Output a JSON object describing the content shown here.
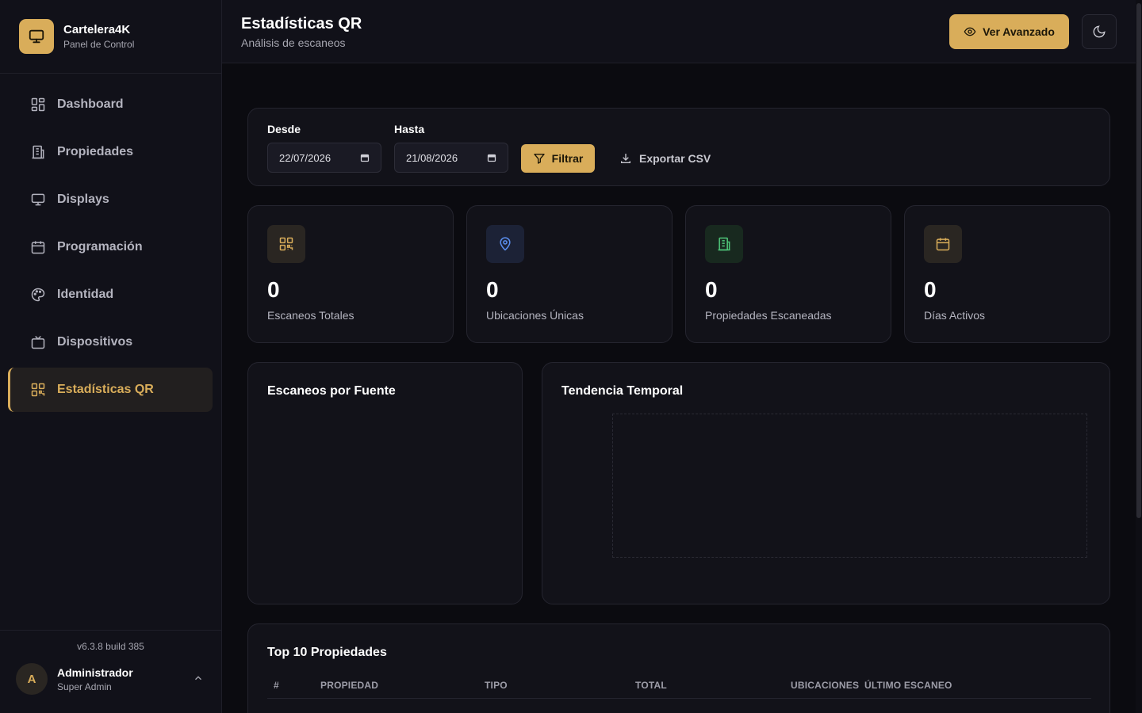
{
  "brand": {
    "title": "Cartelera4K",
    "subtitle": "Panel de Control",
    "logo_icon": "monitor-icon"
  },
  "sidebar": {
    "items": [
      {
        "label": "Dashboard",
        "icon": "dashboard-icon"
      },
      {
        "label": "Propiedades",
        "icon": "building-icon"
      },
      {
        "label": "Displays",
        "icon": "monitor-icon"
      },
      {
        "label": "Programación",
        "icon": "calendar-icon"
      },
      {
        "label": "Identidad",
        "icon": "palette-icon"
      },
      {
        "label": "Dispositivos",
        "icon": "tv-icon"
      },
      {
        "label": "Estadísticas QR",
        "icon": "qr-icon",
        "active": true
      }
    ],
    "version": "v6.3.8 build 385",
    "user": {
      "initial": "A",
      "name": "Administrador",
      "role": "Super Admin"
    }
  },
  "header": {
    "title": "Estadísticas QR",
    "subtitle": "Análisis de escaneos",
    "advanced_button": "Ver Avanzado"
  },
  "filters": {
    "from_label": "Desde",
    "from_value": "22/07/2026",
    "to_label": "Hasta",
    "to_value": "21/08/2026",
    "filter_button": "Filtrar",
    "export_button": "Exportar CSV"
  },
  "stats": [
    {
      "value": "0",
      "label": "Escaneos Totales",
      "icon": "qr-icon",
      "color": "#d9ad5a",
      "bg": "#2a2622"
    },
    {
      "value": "0",
      "label": "Ubicaciones Únicas",
      "icon": "map-pin-icon",
      "color": "#5b8ff0",
      "bg": "#1c2236"
    },
    {
      "value": "0",
      "label": "Propiedades Escaneadas",
      "icon": "building-icon",
      "color": "#4fc77a",
      "bg": "#18291f"
    },
    {
      "value": "0",
      "label": "Días Activos",
      "icon": "calendar-icon",
      "color": "#d9ad5a",
      "bg": "#2a2622"
    }
  ],
  "panels": {
    "source_title": "Escaneos por Fuente",
    "trend_title": "Tendencia Temporal"
  },
  "top_table": {
    "title": "Top 10 Propiedades",
    "columns": [
      "#",
      "PROPIEDAD",
      "TIPO",
      "TOTAL",
      "UBICACIONES",
      "ÚLTIMO ESCANEO"
    ]
  },
  "colors": {
    "accent": "#d9ad5a",
    "background": "#0b0b10",
    "surface": "#121219"
  }
}
